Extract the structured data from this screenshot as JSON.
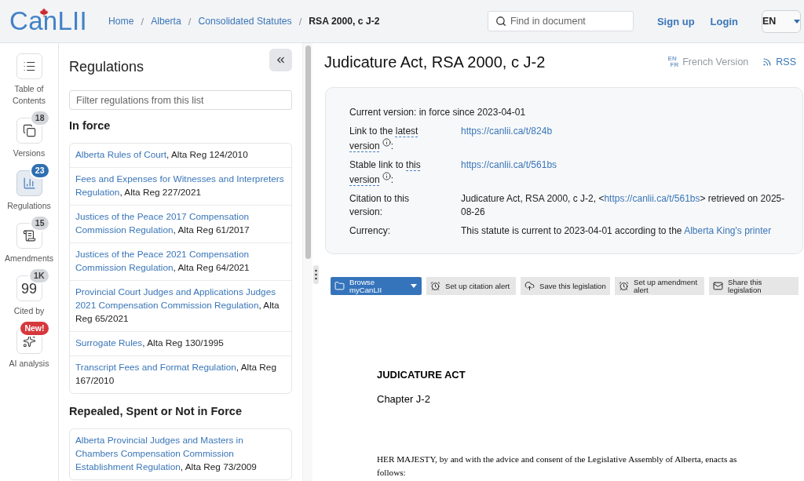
{
  "header": {
    "logo": "CanLII",
    "breadcrumb": {
      "separator": "/",
      "items": [
        {
          "label": "Home",
          "current": false
        },
        {
          "label": "Alberta",
          "current": false
        },
        {
          "label": "Consolidated Statutes",
          "current": false
        },
        {
          "label": "RSA 2000, c J-2",
          "current": true
        }
      ]
    },
    "search": {
      "placeholder": "Find in document"
    },
    "links": [
      "Sign up",
      "Login"
    ],
    "language": "EN"
  },
  "rail": [
    {
      "label": "Table of Contents",
      "selected": false
    },
    {
      "label": "Versions",
      "badge": {
        "text": "18",
        "kind": "count"
      },
      "selected": false
    },
    {
      "label": "Regulations",
      "badge": {
        "text": "23",
        "kind": "count"
      },
      "selected": true
    },
    {
      "label": "Amendments",
      "badge": {
        "text": "15",
        "kind": "count"
      },
      "selected": false
    },
    {
      "label": "Cited by",
      "glyph": "99",
      "badge": {
        "text": "1K",
        "kind": "count"
      },
      "selected": false
    },
    {
      "label": "AI analysis",
      "badge": {
        "text": "New!",
        "kind": "new"
      },
      "selected": false
    }
  ],
  "panel": {
    "title": "Regulations",
    "filter": {
      "placeholder": "Filter regulations from this list"
    },
    "sections": [
      {
        "heading": "In force",
        "items": [
          {
            "link": "Alberta Rules of Court",
            "rest": ", Alta Reg 124/2010"
          },
          {
            "link": "Fees and Expenses for Witnesses and Interpreters Regulation",
            "rest": ", Alta Reg 227/2021"
          },
          {
            "link": "Justices of the Peace 2017 Compensation Commission Regulation",
            "rest": ", Alta Reg 61/2017"
          },
          {
            "link": "Justices of the Peace 2021 Compensation Commission Regulation",
            "rest": ", Alta Reg 64/2021"
          },
          {
            "link": "Provincial Court Judges and Applications Judges 2021 Compensation Commission Regulation",
            "rest": ", Alta Reg 65/2021"
          },
          {
            "link": "Surrogate Rules",
            "rest": ", Alta Reg 130/1995"
          },
          {
            "link": "Transcript Fees and Format Regulation",
            "rest": ", Alta Reg 167/2010"
          }
        ]
      },
      {
        "heading": "Repealed, Spent or Not in Force",
        "items": [
          {
            "link": "Alberta Provincial Judges and Masters in Chambers Compensation Commission Establishment Regulation",
            "rest": ", Alta Reg 73/2009"
          }
        ]
      }
    ]
  },
  "document": {
    "title": "Judicature Act, RSA 2000, c J-2",
    "links": [
      {
        "kind": "language",
        "marks": [
          "EN",
          "FR"
        ],
        "label": "French Version"
      },
      {
        "kind": "rss",
        "label": "RSS"
      }
    ],
    "info": {
      "current": "Current version: in force since 2023-04-01",
      "rows": [
        {
          "label": "Link to the ",
          "term": "latest version",
          "suffix": ":",
          "value": [
            {
              "kind": "link",
              "text": "https://canlii.ca/t/824b"
            }
          ]
        },
        {
          "label": "Stable link to ",
          "term": "this version",
          "suffix": ":",
          "value": [
            {
              "kind": "link",
              "text": "https://canlii.ca/t/561bs"
            }
          ]
        },
        {
          "label": "Citation to this version:",
          "value": [
            {
              "kind": "text",
              "text": "Judicature Act, RSA 2000, c J-2, <"
            },
            {
              "kind": "link",
              "text": "https://canlii.ca/t/561bs"
            },
            {
              "kind": "text",
              "text": "> retrieved on 2025-08-26"
            }
          ]
        },
        {
          "label": "Currency:",
          "value": [
            {
              "kind": "text",
              "text": "This statute is current to 2023-04-01 according to the "
            },
            {
              "kind": "link",
              "text": "Alberta King's printer"
            }
          ]
        }
      ]
    },
    "toolbar": [
      {
        "kind": "primary",
        "label": "Browse myCanLII"
      },
      {
        "kind": "alert",
        "label": "Set up citation alert"
      },
      {
        "kind": "save",
        "label": "Save this legislation"
      },
      {
        "kind": "alert",
        "label": "Set up amendment alert"
      },
      {
        "kind": "share",
        "label": "Share this legislation"
      }
    ],
    "body": {
      "heading": "JUDICATURE ACT",
      "chapter": "Chapter J-2",
      "preamble": "HER MAJESTY, by and with the advice and consent of the Legislative Assembly of Alberta, enacts as follows:"
    }
  }
}
